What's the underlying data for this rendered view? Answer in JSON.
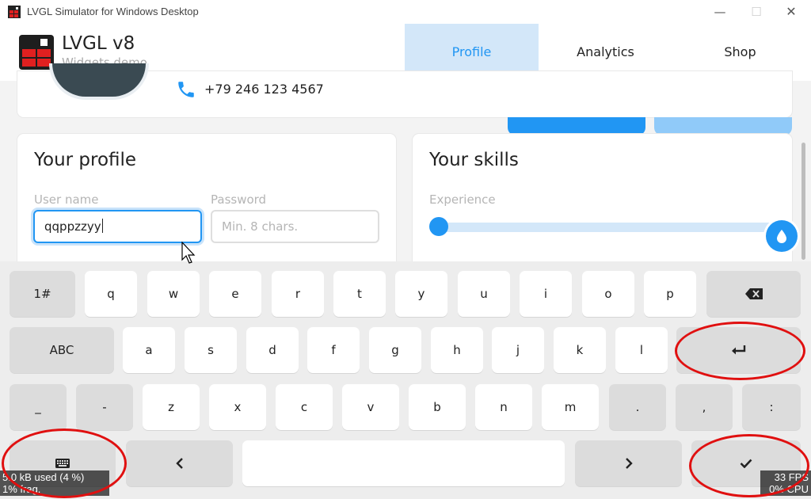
{
  "window": {
    "title": "LVGL Simulator for Windows Desktop",
    "controls": {
      "minimize": "—",
      "maximize": "☐",
      "close": "✕"
    }
  },
  "header": {
    "title": "LVGL v8",
    "subtitle": "Widgets demo",
    "tabs": [
      {
        "label": "Profile",
        "active": true
      },
      {
        "label": "Analytics",
        "active": false
      },
      {
        "label": "Shop",
        "active": false
      }
    ]
  },
  "profile_card": {
    "phone": "+79 246 123 4567"
  },
  "your_profile": {
    "title": "Your profile",
    "username_label": "User name",
    "username_value": "qqppzzyy",
    "password_label": "Password",
    "password_placeholder": "Min. 8 chars."
  },
  "your_skills": {
    "title": "Your skills",
    "experience_label": "Experience",
    "experience_level": 0
  },
  "keyboard": {
    "row1": [
      "1#",
      "q",
      "w",
      "e",
      "r",
      "t",
      "y",
      "u",
      "i",
      "o",
      "p"
    ],
    "row2": [
      "ABC",
      "a",
      "s",
      "d",
      "f",
      "g",
      "h",
      "j",
      "k",
      "l"
    ],
    "row3": [
      "_",
      "-",
      "z",
      "x",
      "c",
      "v",
      "b",
      "n",
      "m",
      ".",
      ",",
      ":"
    ],
    "icons": {
      "backspace": "backspace-icon",
      "enter": "enter-icon",
      "keyboard": "keyboard-icon",
      "left": "chevron-left-icon",
      "right": "chevron-right-icon",
      "ok": "checkmark-icon"
    }
  },
  "overlays": {
    "memory_line1": "5.0 kB used (4 %)",
    "memory_line2": "1% frag.",
    "fps_line1": "33 FPS",
    "fps_line2": "0% CPU"
  },
  "colors": {
    "accent": "#2196f3",
    "accent_light": "#d3e7f9",
    "annotation": "#e01010",
    "lvgl_red": "#e02020"
  }
}
